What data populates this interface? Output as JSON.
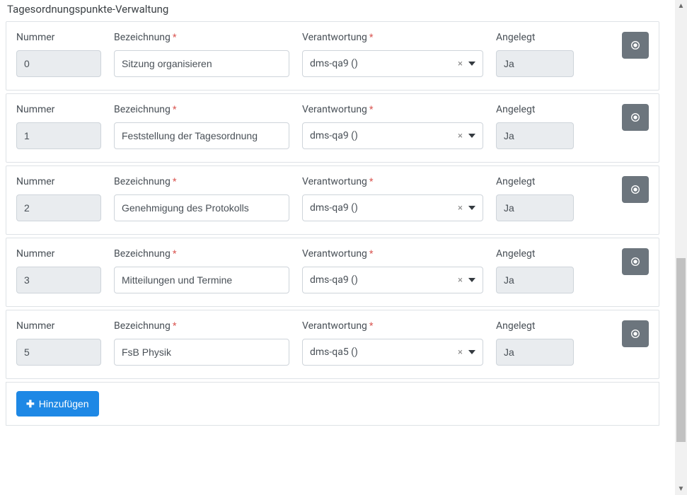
{
  "section_title": "Tagesordnungspunkte-Verwaltung",
  "labels": {
    "nummer": "Nummer",
    "bezeichnung": "Bezeichnung",
    "verantwortung": "Verantwortung",
    "angelegt": "Angelegt"
  },
  "add_button": "Hinzufügen",
  "rows": [
    {
      "nummer": "0",
      "bezeichnung": "Sitzung organisieren",
      "verantwortung": "dms-qa9 ()",
      "angelegt": "Ja"
    },
    {
      "nummer": "1",
      "bezeichnung": "Feststellung der Tagesordnung",
      "verantwortung": "dms-qa9 ()",
      "angelegt": "Ja"
    },
    {
      "nummer": "2",
      "bezeichnung": "Genehmigung des Protokolls",
      "verantwortung": "dms-qa9 ()",
      "angelegt": "Ja"
    },
    {
      "nummer": "3",
      "bezeichnung": "Mitteilungen und Termine",
      "verantwortung": "dms-qa9 ()",
      "angelegt": "Ja"
    },
    {
      "nummer": "5",
      "bezeichnung": "FsB Physik",
      "verantwortung": "dms-qa5 ()",
      "angelegt": "Ja"
    }
  ]
}
